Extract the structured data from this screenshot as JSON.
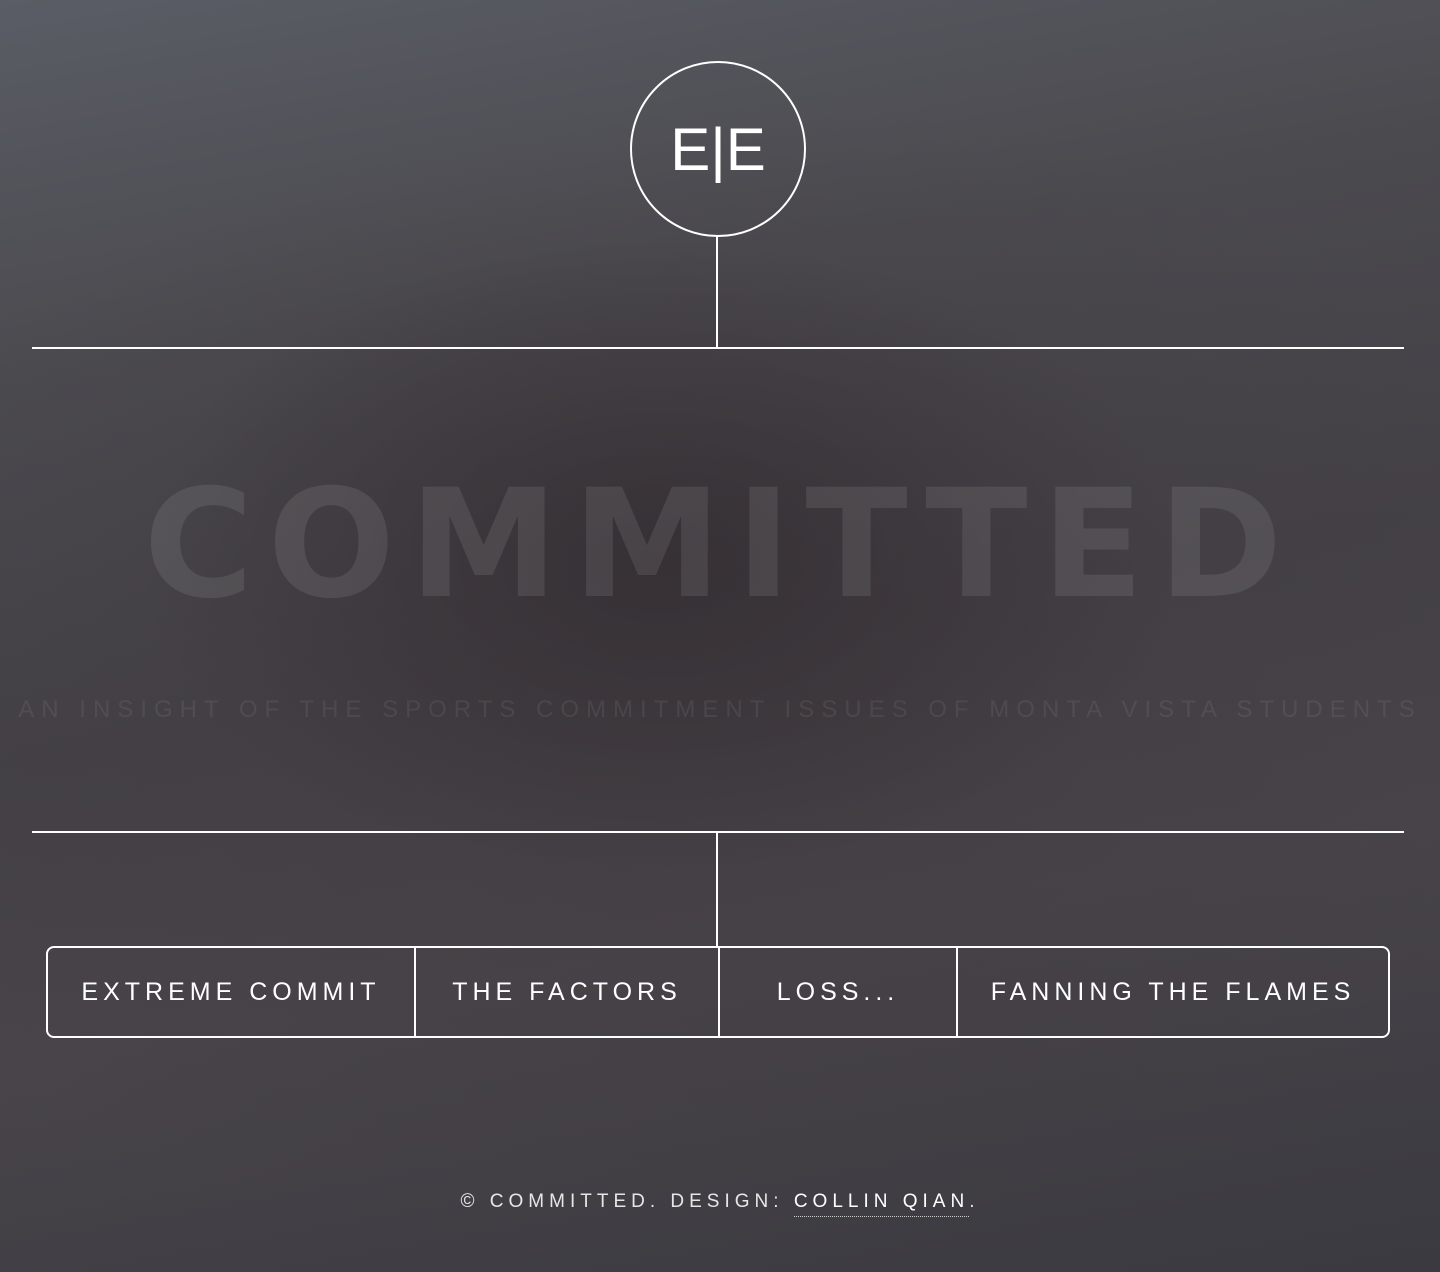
{
  "logo": {
    "text": "E|E"
  },
  "hero": {
    "title": "COMMITTED",
    "subtitle": "AN INSIGHT OF THE SPORTS COMMITMENT ISSUES OF MONTA VISTA STUDENTS"
  },
  "nav": {
    "items": [
      {
        "label": "EXTREME COMMIT"
      },
      {
        "label": "THE FACTORS"
      },
      {
        "label": "LOSS..."
      },
      {
        "label": "FANNING THE FLAMES"
      }
    ]
  },
  "footer": {
    "prefix": "© COMMITTED. DESIGN: ",
    "designer": "COLLIN QIAN",
    "suffix": "."
  },
  "colors": {
    "line": "#ffffff",
    "background_top": "#5a5d65",
    "background_bottom": "#3a3a40"
  }
}
